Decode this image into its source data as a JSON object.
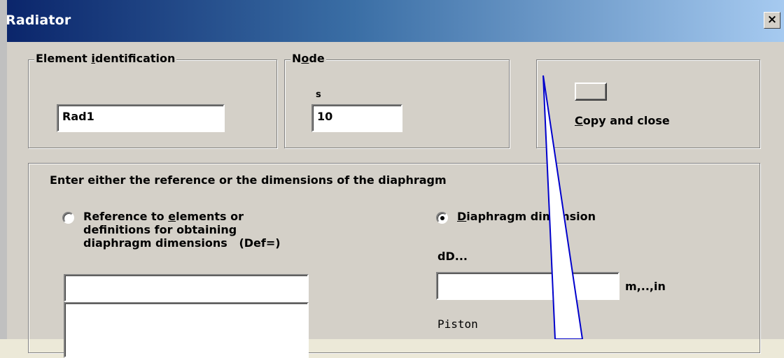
{
  "window": {
    "title": "Radiator",
    "close_label": "×"
  },
  "element_identification": {
    "legend_pre": "Element ",
    "legend_key": "i",
    "legend_post": "dentification",
    "value": "Rad1"
  },
  "node": {
    "legend_pre": "N",
    "legend_key": "o",
    "legend_post": "de",
    "sublabel": "s",
    "value": "10"
  },
  "copy": {
    "key": "C",
    "label_rest": "opy and close"
  },
  "diaphragm": {
    "instruction": "Enter either the reference or the dimensions of the diaphragm",
    "radio_reference": {
      "line1_pre": "Reference to ",
      "line1_key": "e",
      "line1_post": "lements or",
      "line2": "definitions for obtaining",
      "line3": "diaphragm dimensions   (Def=)",
      "selected": false
    },
    "reference_value": "",
    "radio_dimension": {
      "key": "D",
      "label_rest": "iaphragm dimension",
      "selected": true
    },
    "dd_label": "dD...",
    "dd_value": "",
    "units": "m,..,in",
    "piston": "Piston"
  }
}
